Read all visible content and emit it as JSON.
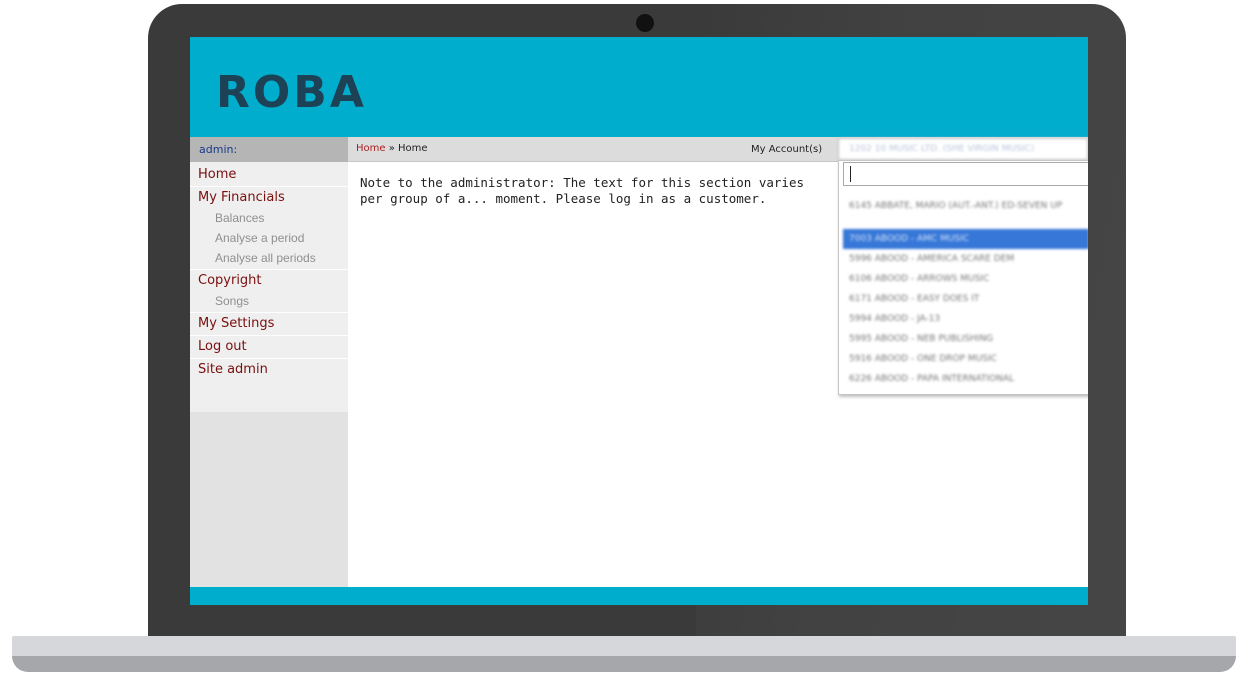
{
  "app": {
    "logo_text": "ROBA"
  },
  "sidebar": {
    "user_label": "admin:",
    "items": [
      {
        "label": "Home",
        "kind": "main"
      },
      {
        "label": "My Financials",
        "kind": "main"
      },
      {
        "label": "Balances",
        "kind": "sub"
      },
      {
        "label": "Analyse a period",
        "kind": "sub"
      },
      {
        "label": "Analyse all periods",
        "kind": "sub"
      },
      {
        "label": "Copyright",
        "kind": "main"
      },
      {
        "label": "Songs",
        "kind": "sub"
      },
      {
        "label": "My Settings",
        "kind": "main"
      },
      {
        "label": "Log out",
        "kind": "main"
      },
      {
        "label": "Site admin",
        "kind": "main"
      }
    ]
  },
  "breadcrumb": {
    "link": "Home",
    "separator": "»",
    "current": "Home"
  },
  "account": {
    "label": "My Account(s)",
    "selected": "1202 10 MUSIC LTD. (SHE VIRGIN MUSIC)",
    "search_value": "",
    "options": [
      "6145 ABBATE, MARIO (AUT.-ANT.) ED-SEVEN UP",
      "7003 ABOOD - AMC MUSIC",
      "5996 ABOOD - AMERICA SCARE DEM",
      "6106 ABOOD - ARROWS MUSIC",
      "6171 ABOOD - EASY DOES IT",
      "5994 ABOOD - JA-13",
      "5995 ABOOD - NEB PUBLISHING",
      "5916 ABOOD - ONE DROP MUSIC",
      "6226 ABOOD - PAPA INTERNATIONAL"
    ],
    "highlighted_index": 1,
    "highlight_color": "#3677d8"
  },
  "main": {
    "note": "Note to the administrator: The text for this section varies per group of a... moment. Please log in as a customer."
  },
  "colors": {
    "header": "#00adcd",
    "logo": "#1d4155",
    "menu_link": "#7a0f0f"
  }
}
